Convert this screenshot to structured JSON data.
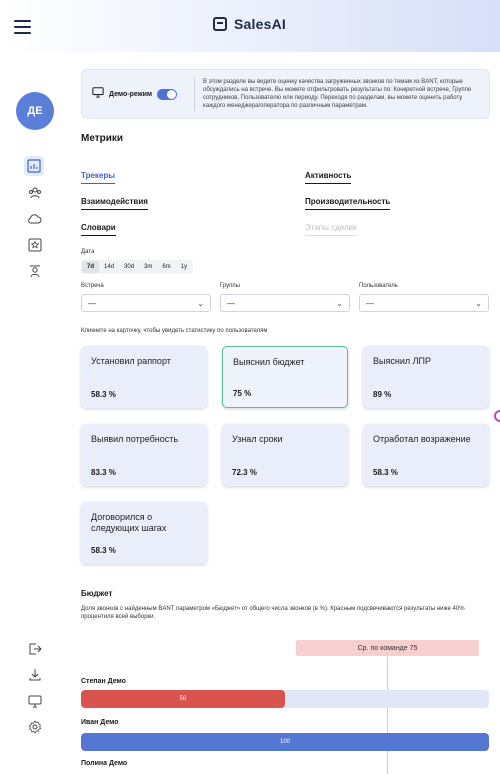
{
  "app": {
    "logo_text": "SalesAI"
  },
  "user": {
    "initials": "ДЕ"
  },
  "colors": {
    "accent": "#4f74d0",
    "avatar": "#5b7fd6",
    "card_bg": "#eaeefb",
    "selected_border": "#5ebf97",
    "bar_red": "#d9544f",
    "bar_blue": "#5577d4",
    "bar_track": "#e1e7f7",
    "avg_badge": "#f7cfcf"
  },
  "info": {
    "demo_label": "Демо-режим",
    "text": "В этом разделе вы видите оценку качества загруженных звонков по темам из BANT, которые обсуждались на встрече. Вы можете отфильтровать результаты по: Конкретной встрече, Группе сотрудников, Пользователю или периоду. Переходя по разделам, вы можете оценить работу каждого менеджера/оператора по различным параметрам."
  },
  "metrics": {
    "title": "Метрики",
    "tabs": [
      {
        "label": "Трекеры"
      },
      {
        "label": "Активность"
      },
      {
        "label": "Взаимодействия"
      },
      {
        "label": "Производительность"
      },
      {
        "label": "Словари"
      },
      {
        "label": "Этапы сделки"
      }
    ]
  },
  "filters": {
    "date_label": "Дата",
    "date_options": [
      "7d",
      "14d",
      "30d",
      "3m",
      "6m",
      "1y"
    ],
    "selected_date": "7d",
    "meeting": {
      "label": "Встреча",
      "value": "—"
    },
    "groups": {
      "label": "Группы",
      "value": "—"
    },
    "user": {
      "label": "Пользователь",
      "value": "—"
    }
  },
  "hint": "Кликните на карточку, чтобы увидеть статистику по пользователям",
  "cards": [
    {
      "title": "Установил раппорт",
      "value": "58.3 %"
    },
    {
      "title": "Выяснил бюджет",
      "value": "75 %"
    },
    {
      "title": "Выяснил ЛПР",
      "value": "89 %"
    },
    {
      "title": "Выявил потребность",
      "value": "83.3 %"
    },
    {
      "title": "Узнал сроки",
      "value": "72.3 %"
    },
    {
      "title": "Отработал возражение",
      "value": "58.3 %"
    },
    {
      "title": "Договорился о следующих шагах",
      "value": "58.3 %"
    }
  ],
  "budget": {
    "title": "Бюджет",
    "description": "Доля звонков с найденным BANT параметром «Бюджет» от общего числа звонков (в %). Красным подсвечиваются результаты ниже 40% процентиля всей выборки.",
    "average_label": "Ср. по команде 75",
    "rows": [
      {
        "name": "Степан Демо",
        "value": 50,
        "label": "50",
        "color": "red"
      },
      {
        "name": "Иван Демо",
        "value": 100,
        "label": "100",
        "color": "blue"
      },
      {
        "name": "Полина Демо",
        "value": null,
        "label": "",
        "color": "blue"
      }
    ]
  }
}
